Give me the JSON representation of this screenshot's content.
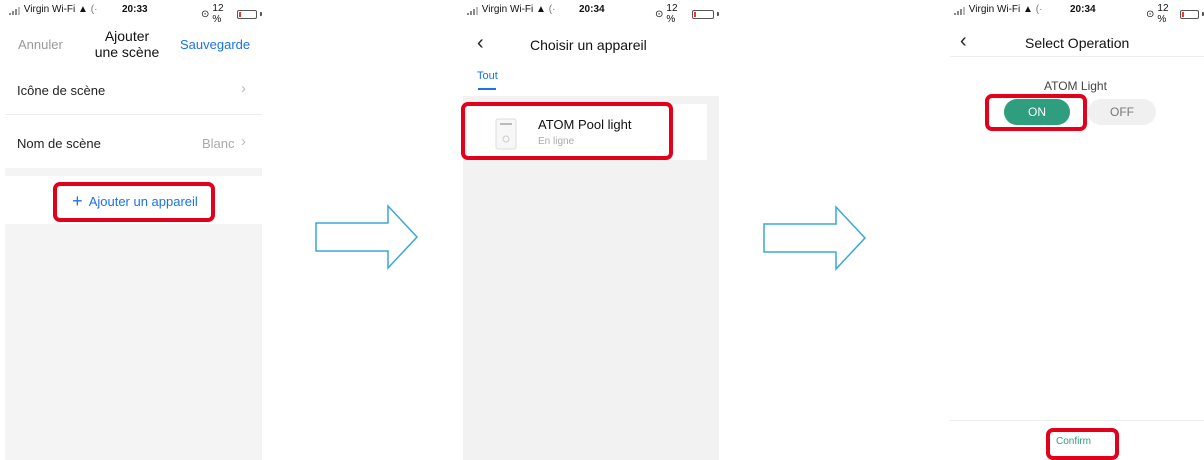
{
  "screens": [
    {
      "status": {
        "carrier": "Virgin Wi-Fi",
        "time": "20:33",
        "battery": "12 %",
        "battery_level": 0.12
      },
      "nav": {
        "cancel": "Annuler",
        "title_line1": "Ajouter",
        "title_line2": "une scène",
        "save": "Sauvegarde"
      },
      "rows": [
        {
          "label": "Icône de scène",
          "value": ""
        },
        {
          "label": "Nom de scène",
          "value": "Blanc"
        }
      ],
      "add_device": "Ajouter un appareil"
    },
    {
      "status": {
        "carrier": "Virgin Wi-Fi",
        "time": "20:34",
        "battery": "12 %",
        "battery_level": 0.12
      },
      "nav": {
        "title": "Choisir un appareil"
      },
      "tab": "Tout",
      "device": {
        "name": "ATOM Pool light",
        "state": "En ligne"
      }
    },
    {
      "status": {
        "carrier": "Virgin Wi-Fi",
        "time": "20:34",
        "battery": "12 %",
        "battery_level": 0.12
      },
      "nav": {
        "title": "Select Operation"
      },
      "device_label": "ATOM Light",
      "on_label": "ON",
      "off_label": "OFF",
      "confirm": "Confirm"
    }
  ],
  "colors": {
    "accent_blue": "#1a73e8",
    "highlight_red": "#e3001b",
    "on_green": "#2e9e7e",
    "arrow_blue": "#3aa8d8"
  }
}
